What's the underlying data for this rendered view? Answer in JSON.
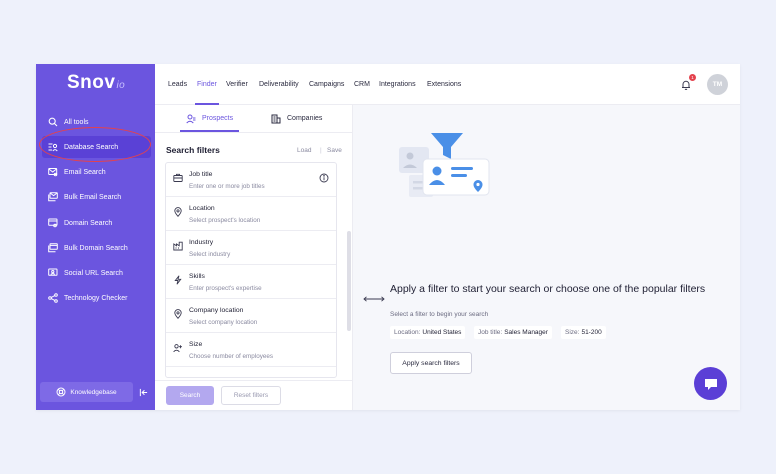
{
  "brand": {
    "name": "Snov",
    "suffix": "io"
  },
  "sidebar": {
    "items": [
      {
        "label": "All tools",
        "icon": "search-icon"
      },
      {
        "label": "Database Search",
        "icon": "database-search-icon"
      },
      {
        "label": "Email Search",
        "icon": "email-search-icon"
      },
      {
        "label": "Bulk Email Search",
        "icon": "bulk-email-icon"
      },
      {
        "label": "Domain Search",
        "icon": "domain-search-icon"
      },
      {
        "label": "Bulk Domain Search",
        "icon": "bulk-domain-icon"
      },
      {
        "label": "Social URL Search",
        "icon": "social-url-icon"
      },
      {
        "label": "Technology Checker",
        "icon": "share-icon"
      }
    ],
    "active_index": 1,
    "knowledgebase_label": "Knowledgebase"
  },
  "topnav": {
    "tabs": [
      "Leads",
      "Finder",
      "Verifier",
      "Deliverability",
      "Campaigns",
      "CRM",
      "Integrations",
      "Extensions"
    ],
    "active_tab": "Finder",
    "notification_count": "1",
    "avatar_initials": "TM"
  },
  "panel": {
    "subtabs": [
      "Prospects",
      "Companies"
    ],
    "active_subtab": "Prospects",
    "title": "Search filters",
    "load_label": "Load",
    "separator": "|",
    "save_label": "Save",
    "filters": [
      {
        "label": "Job title",
        "hint": "Enter one or more job titles",
        "icon": "briefcase-icon"
      },
      {
        "label": "Location",
        "hint": "Select prospect's location",
        "icon": "location-pin-icon"
      },
      {
        "label": "Industry",
        "hint": "Select industry",
        "icon": "factory-icon"
      },
      {
        "label": "Skills",
        "hint": "Enter prospect's expertise",
        "icon": "lightning-icon"
      },
      {
        "label": "Company location",
        "hint": "Select company location",
        "icon": "location-pin-icon"
      },
      {
        "label": "Size",
        "hint": "Choose number of employees",
        "icon": "people-icon"
      }
    ],
    "search_label": "Search",
    "reset_label": "Reset filters"
  },
  "main": {
    "title": "Apply a filter to start your search or choose one of the popular filters",
    "subtitle": "Select a filter to begin your search",
    "chips": [
      {
        "key": "Location:",
        "value": "United States"
      },
      {
        "key": "Job title:",
        "value": "Sales Manager"
      },
      {
        "key": "Size:",
        "value": "51-200"
      }
    ],
    "apply_label": "Apply search filters"
  },
  "colors": {
    "sidebar": "#6b55df",
    "accent": "#6b55df",
    "highlight_ring": "#e4424d",
    "chat_button": "#5b3fd6"
  }
}
